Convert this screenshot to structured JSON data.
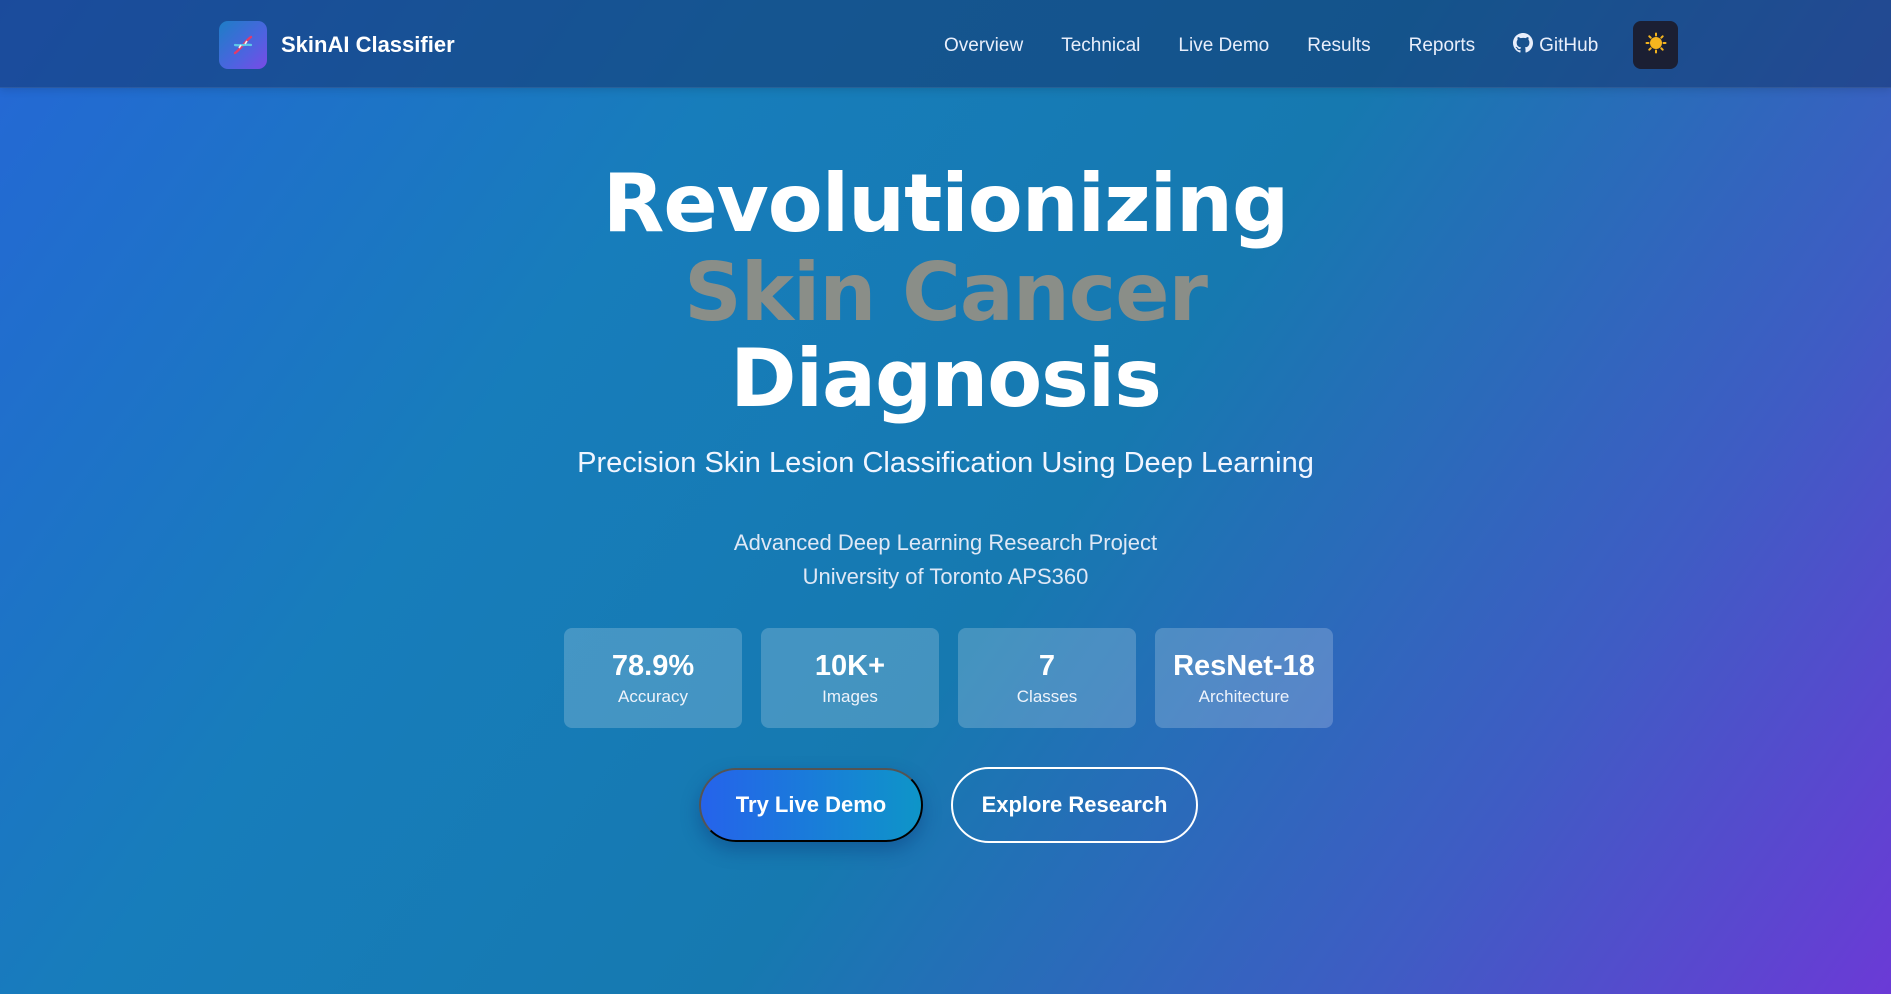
{
  "nav": {
    "brand": "SkinAI Classifier",
    "brand_icon": "dna-icon",
    "links": [
      "Overview",
      "Technical",
      "Live Demo",
      "Results",
      "Reports",
      "GitHub"
    ],
    "github_icon": "github-icon",
    "theme_icon": "sun-icon"
  },
  "hero": {
    "title_line1": "Revolutionizing",
    "title_line2": "Skin Cancer",
    "title_line3": "Diagnosis",
    "subtitle": "Precision Skin Lesion Classification Using Deep Learning",
    "project_line1": "Advanced Deep Learning Research Project",
    "project_line2": "University of Toronto APS360"
  },
  "stats": [
    {
      "value": "78.9%",
      "label": "Accuracy"
    },
    {
      "value": "10K+",
      "label": "Images"
    },
    {
      "value": "7",
      "label": "Classes"
    },
    {
      "value": "ResNet-18",
      "label": "Architecture"
    }
  ],
  "buttons": {
    "primary": "Try Live Demo",
    "secondary": "Explore Research"
  },
  "colors": {
    "accent_blue": "#2563eb",
    "title_highlight": "#8a8e88",
    "theme_toggle_bg": "#1b1f33"
  }
}
